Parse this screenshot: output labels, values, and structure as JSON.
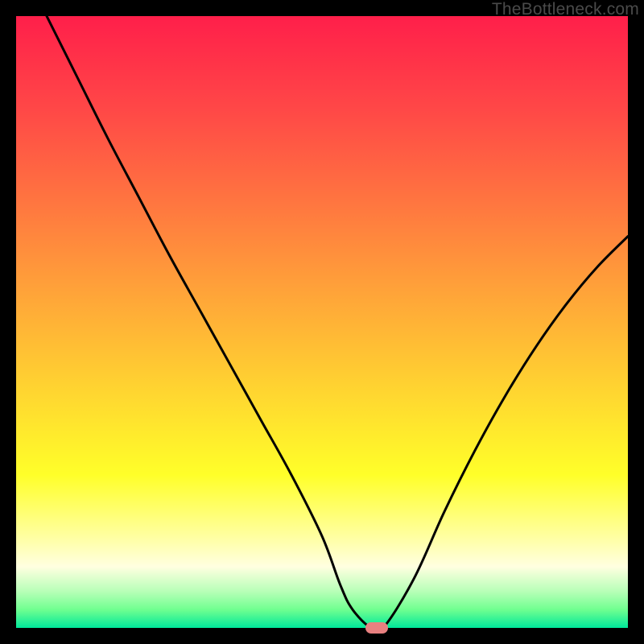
{
  "watermark": "TheBottleneck.com",
  "chart_data": {
    "type": "line",
    "title": "",
    "xlabel": "",
    "ylabel": "",
    "xlim": [
      0,
      100
    ],
    "ylim": [
      0,
      100
    ],
    "series": [
      {
        "name": "curve",
        "x": [
          5,
          10,
          15,
          20,
          25,
          30,
          35,
          40,
          45,
          50,
          53,
          55,
          58,
          60,
          65,
          70,
          75,
          80,
          85,
          90,
          95,
          100
        ],
        "values": [
          100,
          90,
          80,
          70.5,
          61,
          52,
          43,
          34,
          25,
          15,
          7,
          3,
          0,
          0,
          8,
          19,
          29,
          38,
          46,
          53,
          59,
          64
        ]
      }
    ],
    "marker": {
      "x": 59,
      "y": 0
    },
    "colors": {
      "curve": "#000000",
      "marker": "#e88080",
      "gradient_top": "#ff1f4a",
      "gradient_mid": "#ffff29",
      "gradient_bottom": "#00e89a"
    }
  }
}
